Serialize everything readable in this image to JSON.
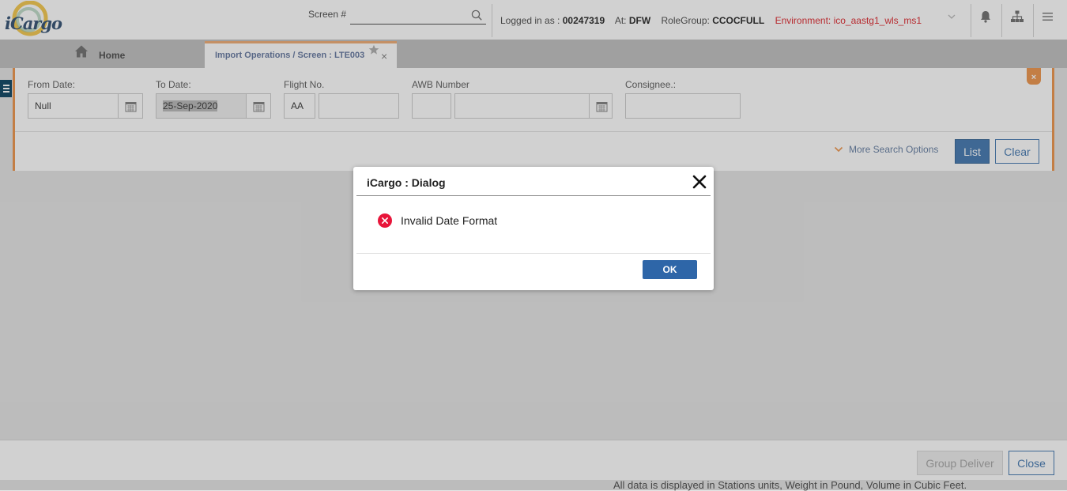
{
  "header": {
    "logo_text": "iCargo",
    "screen_label": "Screen #",
    "screen_value": "",
    "logged_in_label": "Logged in as :",
    "user_id": "00247319",
    "at_label": "At:",
    "station": "DFW",
    "rolegroup_label": "RoleGroup:",
    "rolegroup": "CCOCFULL",
    "environment": "Environment: ico_aastg1_wls_ms1"
  },
  "tabs": {
    "home_label": "Home",
    "active_label": "Import Operations / Screen : LTE003",
    "close_glyph": "×"
  },
  "filters": {
    "from_date_label": "From Date:",
    "from_date_value": "Null",
    "to_date_label": "To Date:",
    "to_date_value": "25-Sep-2020",
    "flight_no_label": "Flight No.",
    "carrier_code": "AA",
    "flight_number": "",
    "awb_label": "AWB Number",
    "awb_prefix": "",
    "awb_number": "",
    "consignee_label": "Consignee.:",
    "consignee_value": "",
    "more_options_label": "More Search Options",
    "list_label": "List",
    "clear_label": "Clear",
    "panel_close_glyph": "×"
  },
  "footer": {
    "group_deliver_label": "Group Deliver",
    "close_label": "Close",
    "units_note": "All data is displayed in Stations units, Weight in Pound, Volume in Cubic Feet."
  },
  "dialog": {
    "title": "iCargo : Dialog",
    "message": "Invalid Date Format",
    "ok_label": "OK"
  },
  "colors": {
    "accent_orange": "#ee9a55",
    "primary_blue": "#4d7fb5",
    "dialog_ok_blue": "#2e66a8",
    "environment_red": "#e0343a",
    "error_red": "#e8153a"
  },
  "icons": [
    "search-icon",
    "bell-icon",
    "sitemap-icon",
    "hamburger-menu-icon",
    "home-icon",
    "star-icon",
    "calendar-icon",
    "chevron-down-icon",
    "close-icon",
    "error-icon"
  ]
}
